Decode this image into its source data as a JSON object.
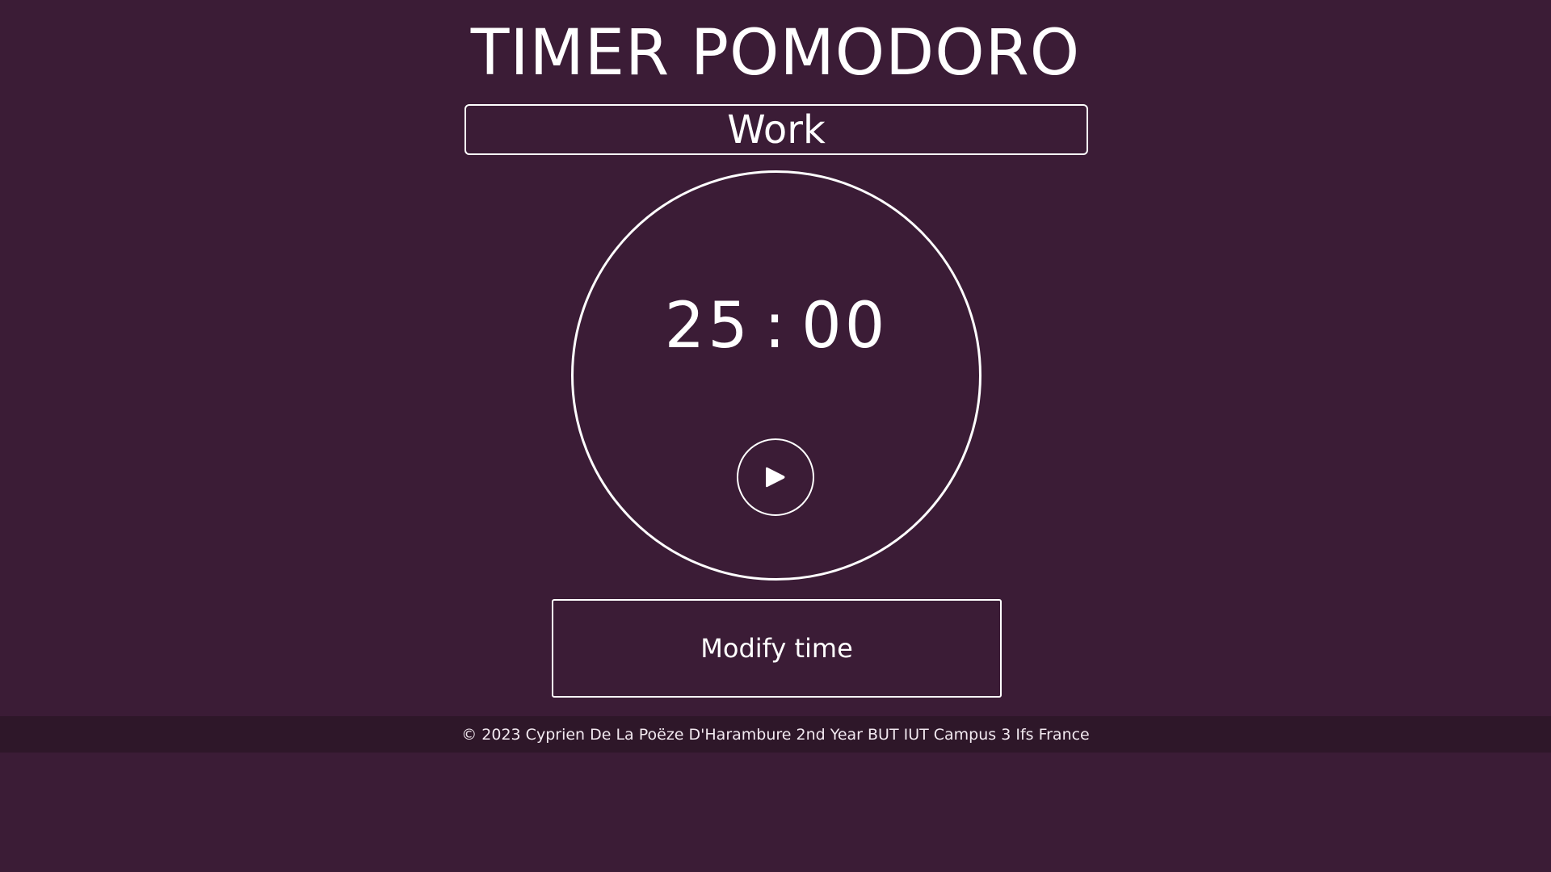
{
  "app": {
    "title": "TIMER POMODORO"
  },
  "mode": {
    "label": "Work"
  },
  "timer": {
    "minutes": "25",
    "separator": ":",
    "seconds": "00",
    "play_icon": "play-icon"
  },
  "actions": {
    "modify_label": "Modify time"
  },
  "footer": {
    "text": "© 2023 Cyprien De La Poëze D'Harambure 2nd Year BUT IUT Campus 3 Ifs France"
  },
  "colors": {
    "background": "#3b1c36",
    "footer_background": "#2e1729",
    "foreground": "#ffffff"
  }
}
